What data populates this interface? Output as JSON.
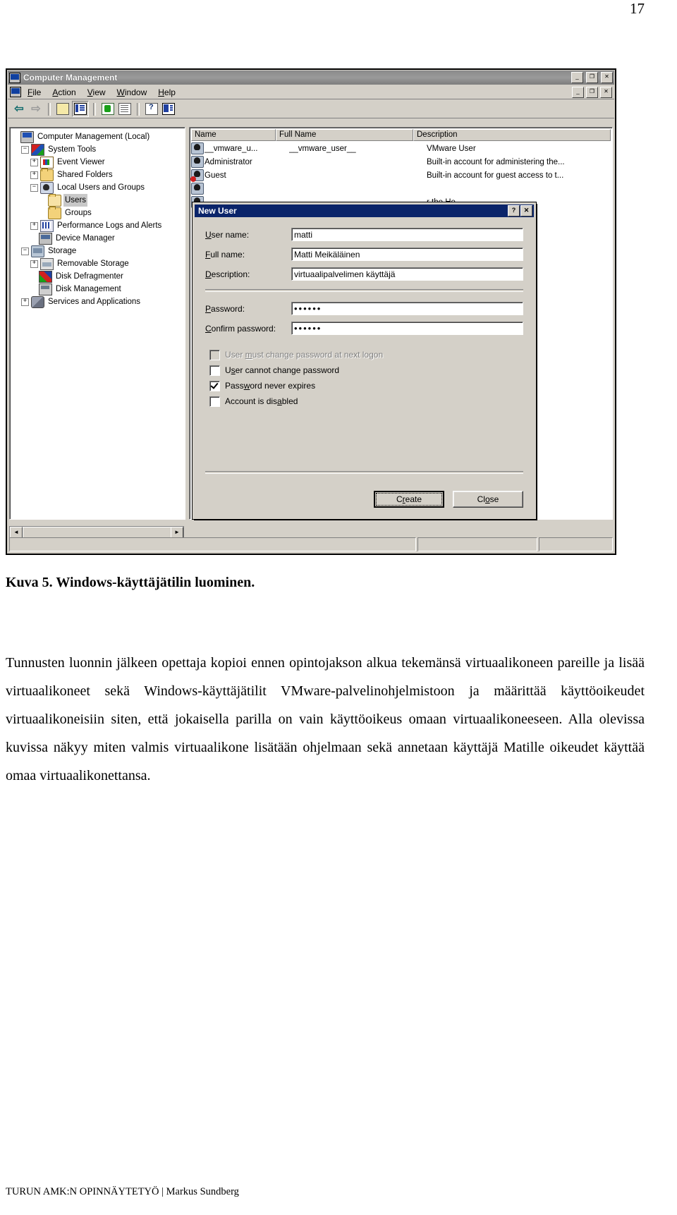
{
  "page": {
    "number": "17"
  },
  "footer": {
    "text": "TURUN AMK:N OPINNÄYTETYÖ | Markus Sundberg"
  },
  "caption": {
    "text": "Kuva 5. Windows-käyttäjätilin luominen."
  },
  "body": {
    "paragraph": "Tunnusten luonnin jälkeen opettaja kopioi ennen opintojakson alkua tekemänsä virtuaalikoneen pareille ja lisää virtuaalikoneet sekä Windows-käyttäjätilit VMware-palvelinohjelmistoon ja määrittää käyttöoikeudet virtuaalikoneisiin siten, että jokaisella parilla on vain käyttöoikeus omaan virtuaalikoneeseen. Alla olevissa kuvissa näkyy miten valmis virtuaalikone lisätään ohjelmaan sekä annetaan käyttäjä Matille oikeudet käyttää omaa virtuaalikonettansa."
  },
  "window": {
    "title": "Computer Management",
    "title_icon": "computer-icon",
    "controls": {
      "minimize": "_",
      "maximize": "❐",
      "close": "✕"
    },
    "menu": [
      {
        "label": "File",
        "accel": "F"
      },
      {
        "label": "Action",
        "accel": "A"
      },
      {
        "label": "View",
        "accel": "V"
      },
      {
        "label": "Window",
        "accel": "W"
      },
      {
        "label": "Help",
        "accel": "H"
      }
    ],
    "child_controls": {
      "minimize": "_",
      "restore": "❐",
      "close": "✕"
    },
    "toolbar": [
      {
        "name": "back-icon",
        "glyph": "⇦"
      },
      {
        "name": "forward-icon",
        "glyph": "⇨"
      },
      {
        "name": "up-one-level-icon",
        "glyph": ""
      },
      {
        "name": "show-hide-console-tree-icon",
        "glyph": ""
      },
      {
        "name": "refresh-icon",
        "glyph": ""
      },
      {
        "name": "export-list-icon",
        "glyph": ""
      },
      {
        "name": "help-icon",
        "glyph": "?"
      },
      {
        "name": "show-hide-action-pane-icon",
        "glyph": ""
      }
    ]
  },
  "tree": {
    "items": [
      {
        "label": "Computer Management (Local)",
        "depth": 0,
        "expander": "",
        "icon": "computer-icon",
        "selected": false
      },
      {
        "label": "System Tools",
        "depth": 1,
        "expander": "−",
        "icon": "system-tools-icon",
        "selected": false
      },
      {
        "label": "Event Viewer",
        "depth": 2,
        "expander": "+",
        "icon": "event-viewer-icon",
        "selected": false
      },
      {
        "label": "Shared Folders",
        "depth": 2,
        "expander": "+",
        "icon": "folder-icon",
        "selected": false
      },
      {
        "label": "Local Users and Groups",
        "depth": 2,
        "expander": "−",
        "icon": "users-icon",
        "selected": false
      },
      {
        "label": "Users",
        "depth": 3,
        "expander": "",
        "icon": "folder-open-icon",
        "selected": true
      },
      {
        "label": "Groups",
        "depth": 3,
        "expander": "",
        "icon": "folder-icon",
        "selected": false
      },
      {
        "label": "Performance Logs and Alerts",
        "depth": 2,
        "expander": "+",
        "icon": "performance-icon",
        "selected": false
      },
      {
        "label": "Device Manager",
        "depth": 2,
        "expander": "",
        "icon": "device-manager-icon",
        "selected": false
      },
      {
        "label": "Storage",
        "depth": 1,
        "expander": "−",
        "icon": "storage-icon",
        "selected": false
      },
      {
        "label": "Removable Storage",
        "depth": 2,
        "expander": "+",
        "icon": "removable-storage-icon",
        "selected": false
      },
      {
        "label": "Disk Defragmenter",
        "depth": 2,
        "expander": "",
        "icon": "disk-defragmenter-icon",
        "selected": false
      },
      {
        "label": "Disk Management",
        "depth": 2,
        "expander": "",
        "icon": "disk-management-icon",
        "selected": false
      },
      {
        "label": "Services and Applications",
        "depth": 1,
        "expander": "+",
        "icon": "services-icon",
        "selected": false
      }
    ]
  },
  "list": {
    "columns": [
      "Name",
      "Full Name",
      "Description"
    ],
    "rows": [
      {
        "name": "__vmware_u...",
        "full_name": "__vmware_user__",
        "description": "VMware User",
        "icon": "user-icon"
      },
      {
        "name": "Administrator",
        "full_name": "",
        "description": "Built-in account for administering the...",
        "icon": "user-icon"
      },
      {
        "name": "Guest",
        "full_name": "",
        "description": "Built-in account for guest access to t...",
        "icon": "user-disabled-icon"
      },
      {
        "name": "",
        "full_name": "",
        "description": "",
        "icon": "user-icon"
      },
      {
        "name": "",
        "full_name": "",
        "description": "r the He...",
        "icon": "user-icon"
      }
    ]
  },
  "scrollbar": {
    "left_arrow": "◄",
    "right_arrow": "►"
  },
  "dialog": {
    "title": "New User",
    "help_button": "?",
    "close_button": "✕",
    "fields": [
      {
        "label_pre": "",
        "label_accel": "U",
        "label_post": "ser name:",
        "value": "matti",
        "name": "user-name"
      },
      {
        "label_pre": "",
        "label_accel": "F",
        "label_post": "ull name:",
        "value": "Matti Meikäläinen",
        "name": "full-name"
      },
      {
        "label_pre": "",
        "label_accel": "D",
        "label_post": "escription:",
        "value": "virtuaalipalvelimen käyttäjä",
        "name": "description"
      }
    ],
    "passwords": [
      {
        "label_accel": "P",
        "label_post": "assword:",
        "value": "••••••",
        "name": "password"
      },
      {
        "label_accel": "C",
        "label_post": "onfirm password:",
        "value": "••••••",
        "name": "confirm-password"
      }
    ],
    "checkboxes": [
      {
        "label_pre": "User ",
        "accel": "m",
        "label_post": "ust change password at next logon",
        "checked": false,
        "disabled": true,
        "name": "user-must-change-password"
      },
      {
        "label_pre": "U",
        "accel": "s",
        "label_post": "er cannot change password",
        "checked": false,
        "disabled": false,
        "name": "user-cannot-change-password"
      },
      {
        "label_pre": "Pass",
        "accel": "w",
        "label_post": "ord never expires",
        "checked": true,
        "disabled": false,
        "name": "password-never-expires"
      },
      {
        "label_pre": "Account is dis",
        "accel": "a",
        "label_post": "bled",
        "checked": false,
        "disabled": false,
        "name": "account-is-disabled"
      }
    ],
    "buttons": [
      {
        "label_pre": "C",
        "accel": "r",
        "label_post": "eate",
        "default": true,
        "name": "create"
      },
      {
        "label_pre": "Cl",
        "accel": "o",
        "label_post": "se",
        "default": false,
        "name": "close"
      }
    ]
  }
}
